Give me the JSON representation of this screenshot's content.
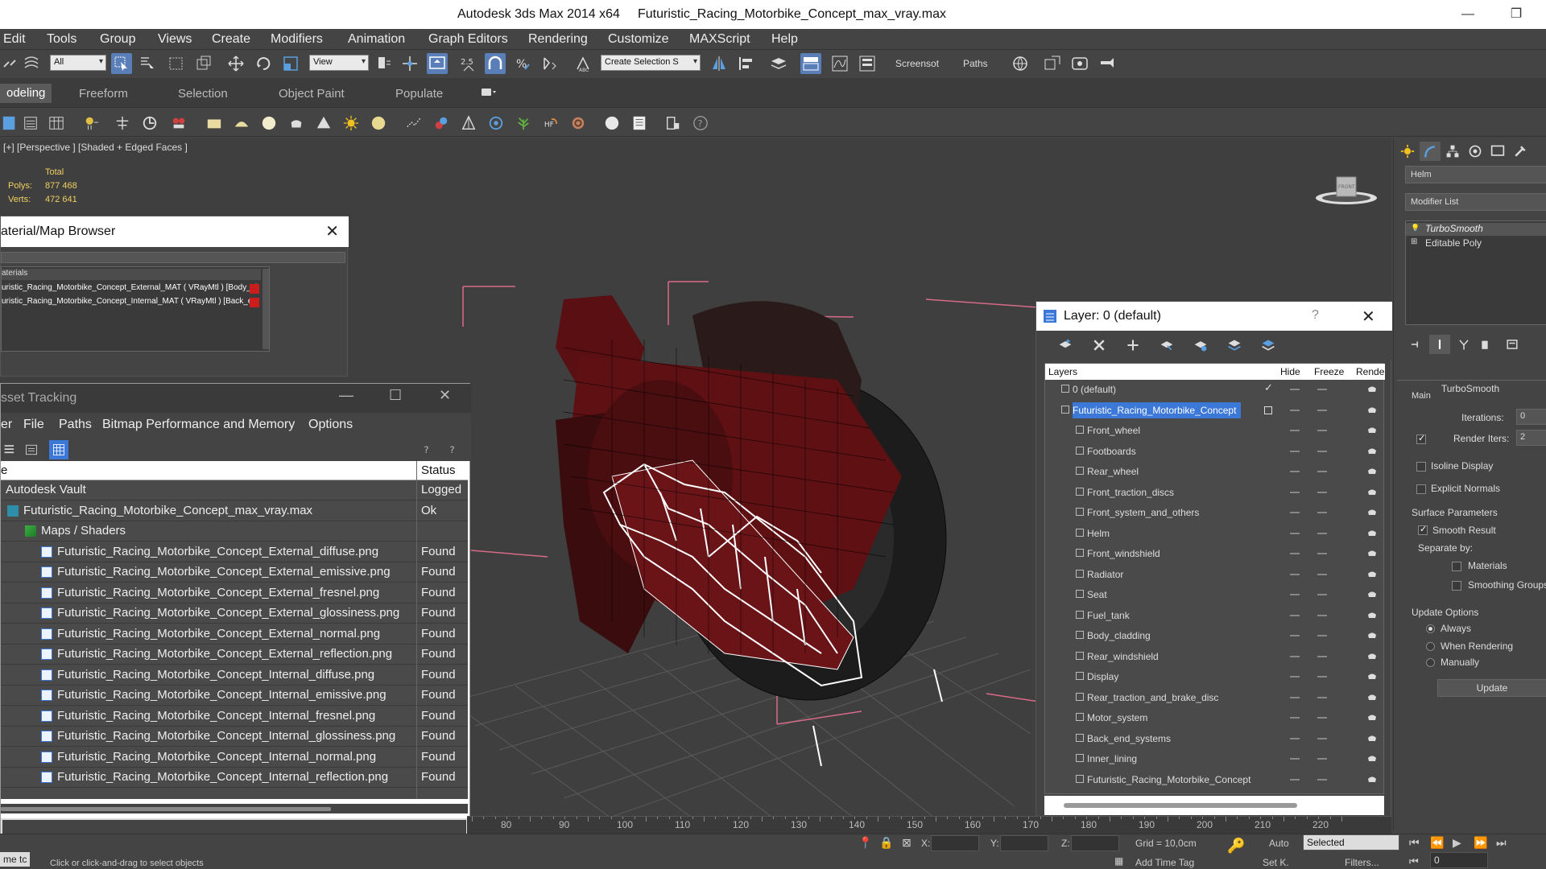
{
  "window": {
    "title": "Autodesk 3ds Max  2014 x64",
    "file": "Futuristic_Racing_Motorbike_Concept_max_vray.max",
    "minimize": "—",
    "restore": "❐"
  },
  "menu": [
    "Edit",
    "Tools",
    "Group",
    "Views",
    "Create",
    "Modifiers",
    "Animation",
    "Graph Editors",
    "Rendering",
    "Customize",
    "MAXScript",
    "Help"
  ],
  "toolbar": {
    "filter": "All",
    "ref_coord": "View",
    "snap_value": "2.5",
    "selection_set": "Create Selection S",
    "screenshot_label": "Screensot",
    "paths_label": "Paths"
  },
  "ribbon": {
    "tabs": [
      "odeling",
      "Freeform",
      "Selection",
      "Object Paint",
      "Populate"
    ]
  },
  "viewport": {
    "label": "[+] [Perspective ] [Shaded + Edged Faces ]",
    "stats_total": "Total",
    "polys_label": "Polys:",
    "polys_value": "877 468",
    "verts_label": "Verts:",
    "verts_value": "472 641",
    "viewcube_label": "FRONT"
  },
  "material_browser": {
    "title": "aterial/Map Browser",
    "close": "✕",
    "group_label": "aterials",
    "materials": [
      "uristic_Racing_Motorbike_Concept_External_MAT ( VRayMtl ) [Body_cla...",
      "uristic_Racing_Motorbike_Concept_Internal_MAT ( VRayMtl ) [Back_end..."
    ]
  },
  "asset_tracking": {
    "title": "sset Tracking",
    "minimize": "—",
    "maximize": "☐",
    "close": "✕",
    "menu": [
      "er",
      "File",
      "Paths",
      "Bitmap Performance and Memory",
      "Options"
    ],
    "col_name": "e",
    "col_status": "Status",
    "rows": [
      {
        "name": "Autodesk Vault",
        "status": "Logged",
        "indent": 0,
        "icon": "vault"
      },
      {
        "name": "Futuristic_Racing_Motorbike_Concept_max_vray.max",
        "status": "Ok",
        "indent": 1,
        "icon": "max"
      },
      {
        "name": "Maps / Shaders",
        "status": "",
        "indent": 2,
        "icon": "maps"
      },
      {
        "name": "Futuristic_Racing_Motorbike_Concept_External_diffuse.png",
        "status": "Found",
        "indent": 3,
        "icon": "file"
      },
      {
        "name": "Futuristic_Racing_Motorbike_Concept_External_emissive.png",
        "status": "Found",
        "indent": 3,
        "icon": "file"
      },
      {
        "name": "Futuristic_Racing_Motorbike_Concept_External_fresnel.png",
        "status": "Found",
        "indent": 3,
        "icon": "file"
      },
      {
        "name": "Futuristic_Racing_Motorbike_Concept_External_glossiness.png",
        "status": "Found",
        "indent": 3,
        "icon": "file"
      },
      {
        "name": "Futuristic_Racing_Motorbike_Concept_External_normal.png",
        "status": "Found",
        "indent": 3,
        "icon": "file"
      },
      {
        "name": "Futuristic_Racing_Motorbike_Concept_External_reflection.png",
        "status": "Found",
        "indent": 3,
        "icon": "file"
      },
      {
        "name": "Futuristic_Racing_Motorbike_Concept_Internal_diffuse.png",
        "status": "Found",
        "indent": 3,
        "icon": "file"
      },
      {
        "name": "Futuristic_Racing_Motorbike_Concept_Internal_emissive.png",
        "status": "Found",
        "indent": 3,
        "icon": "file"
      },
      {
        "name": "Futuristic_Racing_Motorbike_Concept_Internal_fresnel.png",
        "status": "Found",
        "indent": 3,
        "icon": "file"
      },
      {
        "name": "Futuristic_Racing_Motorbike_Concept_Internal_glossiness.png",
        "status": "Found",
        "indent": 3,
        "icon": "file"
      },
      {
        "name": "Futuristic_Racing_Motorbike_Concept_Internal_normal.png",
        "status": "Found",
        "indent": 3,
        "icon": "file"
      },
      {
        "name": "Futuristic_Racing_Motorbike_Concept_Internal_reflection.png",
        "status": "Found",
        "indent": 3,
        "icon": "file"
      }
    ]
  },
  "layer_dialog": {
    "title": "Layer: 0 (default)",
    "help": "?",
    "close": "✕",
    "col_layers": "Layers",
    "col_hide": "Hide",
    "col_freeze": "Freeze",
    "col_render": "Rende",
    "layers": [
      {
        "name": "0 (default)",
        "level": 0,
        "selected": false,
        "current": true
      },
      {
        "name": "Futuristic_Racing_Motorbike_Concept",
        "level": 0,
        "selected": true,
        "current": false
      },
      {
        "name": "Front_wheel",
        "level": 1
      },
      {
        "name": "Footboards",
        "level": 1
      },
      {
        "name": "Rear_wheel",
        "level": 1
      },
      {
        "name": "Front_traction_discs",
        "level": 1
      },
      {
        "name": "Front_system_and_others",
        "level": 1
      },
      {
        "name": "Helm",
        "level": 1
      },
      {
        "name": "Front_windshield",
        "level": 1
      },
      {
        "name": "Radiator",
        "level": 1
      },
      {
        "name": "Seat",
        "level": 1
      },
      {
        "name": "Fuel_tank",
        "level": 1
      },
      {
        "name": "Body_cladding",
        "level": 1
      },
      {
        "name": "Rear_windshield",
        "level": 1
      },
      {
        "name": "Display",
        "level": 1
      },
      {
        "name": "Rear_traction_and_brake_disc",
        "level": 1
      },
      {
        "name": "Motor_system",
        "level": 1
      },
      {
        "name": "Back_end_systems",
        "level": 1
      },
      {
        "name": "Inner_lining",
        "level": 1
      },
      {
        "name": "Futuristic_Racing_Motorbike_Concept",
        "level": 1
      }
    ]
  },
  "command_panel": {
    "object_name": "Helm",
    "modifier_list": "Modifier List",
    "stack": [
      "TurboSmooth",
      "Editable Poly"
    ],
    "rollout_title": "TurboSmooth",
    "main_label": "Main",
    "iterations_label": "Iterations:",
    "iterations_value": "0",
    "render_iters_label": "Render Iters:",
    "render_iters_value": "2",
    "isoline": "Isoline Display",
    "explicit_normals": "Explicit Normals",
    "surface_params": "Surface Parameters",
    "smooth_result": "Smooth Result",
    "separate_by": "Separate by:",
    "materials": "Materials",
    "smoothing_groups": "Smoothing Groups",
    "update_options": "Update Options",
    "always": "Always",
    "when_rendering": "When Rendering",
    "manually": "Manually",
    "update_button": "Update"
  },
  "timeline": {
    "ticks": [
      "80",
      "90",
      "100",
      "110",
      "120",
      "130",
      "140",
      "150",
      "160",
      "170",
      "180",
      "190",
      "200",
      "210",
      "220"
    ]
  },
  "status": {
    "prompt": "Click or click-and-drag to select objects",
    "left_label": "me  tc",
    "x_label": "X:",
    "y_label": "Y:",
    "z_label": "Z:",
    "grid": "Grid = 10,0cm",
    "auto": "Auto",
    "selected": "Selected",
    "set_key": "Set K.",
    "filters": "Filters...",
    "add_time_tag": "Add Time Tag",
    "frame": "0"
  },
  "colors": {
    "accent": "#3b78d8",
    "material_swatch": "#cc1d1d",
    "stats": "#f0d060",
    "grid_pink": "#d86a8a"
  }
}
